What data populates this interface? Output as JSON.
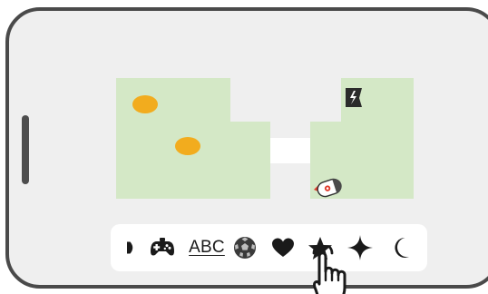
{
  "toolbar": {
    "items": [
      {
        "name": "play-icon"
      },
      {
        "name": "gamepad-icon"
      },
      {
        "name": "text-tool",
        "label": "ABC"
      },
      {
        "name": "soccer-ball-icon"
      },
      {
        "name": "heart-icon"
      },
      {
        "name": "star-icon"
      },
      {
        "name": "sparkle-icon"
      },
      {
        "name": "moon-icon"
      }
    ]
  },
  "colors": {
    "phone_frame": "#4a4a4a",
    "screen_background": "#efefef",
    "map_area": "#d4e8c6",
    "coin": "#f2ac1e",
    "icon": "#1a1a1a",
    "robot_marker": "#e03b2c"
  }
}
